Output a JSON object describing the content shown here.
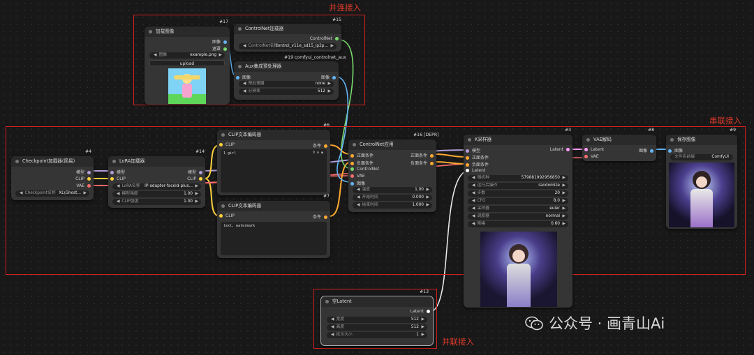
{
  "annotations": {
    "parallel_top": "并连接入",
    "series": "串联接入",
    "parallel_bottom": "并联接入"
  },
  "nodes": {
    "load_image": {
      "id": "#17",
      "title": "加载图像",
      "outputs": [
        "图像",
        "遮罩"
      ],
      "widget_label": "图像",
      "widget_value": "example.png",
      "upload_label": "upload"
    },
    "controlnet_loader": {
      "id": "#15",
      "title": "ControlNet加载器",
      "output": "ControlNet",
      "widget_label": "ControlNet名称",
      "widget_value": "control_v11e_sd15_ip2p..."
    },
    "aux_preprocessor": {
      "id": "#19 comfyui_controlnet_aux",
      "title": "Aux集成预处理器",
      "input": "图像",
      "output": "图像",
      "widgets": [
        {
          "label": "预处理器",
          "value": "none"
        },
        {
          "label": "分辨率",
          "value": "512"
        }
      ]
    },
    "checkpoint_loader": {
      "id": "#4",
      "title": "Checkpoint加载器(简易)",
      "outputs": [
        "模型",
        "CLIP",
        "VAE"
      ],
      "widget_label": "Checkpoint名称",
      "widget_value": "XL\\Ghost..."
    },
    "lora_loader": {
      "id": "#14",
      "title": "LoRA加载器",
      "inputs": [
        "模型",
        "CLIP"
      ],
      "outputs": [
        "模型",
        "CLIP"
      ],
      "widgets": [
        {
          "label": "LoRA名称",
          "value": "IP-adapter-faceid-plus..."
        },
        {
          "label": "模型强度",
          "value": "1.00"
        },
        {
          "label": "CLIP强度",
          "value": "1.00"
        }
      ]
    },
    "clip_text_pos": {
      "id": "#6",
      "title": "CLIP文本编码器",
      "input": "CLIP",
      "output": "条件",
      "text": "1 girl"
    },
    "clip_text_neg": {
      "id": "#7",
      "title": "CLIP文本编码器",
      "input": "CLIP",
      "output": "条件",
      "text": "text, watermark"
    },
    "controlnet_apply": {
      "id": "#16 [DEPR]",
      "title": "ControlNet应用",
      "inputs": [
        "正面条件",
        "负面条件",
        "ControlNet",
        "VAE",
        "图像"
      ],
      "outputs": [
        "正面条件",
        "负面条件"
      ],
      "widgets": [
        {
          "label": "强度",
          "value": "1.00"
        },
        {
          "label": "开始时间",
          "value": "0.000"
        },
        {
          "label": "结束时间",
          "value": "1.000"
        }
      ]
    },
    "ksampler": {
      "id": "#3",
      "title": "K采样器",
      "inputs": [
        "模型",
        "正面条件",
        "负面条件",
        "Latent"
      ],
      "output": "Latent",
      "widgets": [
        {
          "label": "随机种",
          "value": "579881992956850"
        },
        {
          "label": "运行后操作",
          "value": "randomize"
        },
        {
          "label": "步数",
          "value": "20"
        },
        {
          "label": "CFG",
          "value": "8.0"
        },
        {
          "label": "采样器",
          "value": "euler"
        },
        {
          "label": "调度器",
          "value": "normal"
        },
        {
          "label": "降噪",
          "value": "0.60"
        }
      ]
    },
    "vae_decode": {
      "id": "#8",
      "title": "VAE解码",
      "inputs": [
        "Latent",
        "VAE"
      ],
      "output": "图像"
    },
    "save_image": {
      "id": "#9",
      "title": "保存图像",
      "input": "图像",
      "widget_label": "文件名前缀",
      "widget_value": "ComfyUI"
    },
    "empty_latent": {
      "id": "#13",
      "title": "空Latent",
      "output": "Latent",
      "widgets": [
        {
          "label": "宽度",
          "value": "512"
        },
        {
          "label": "高度",
          "value": "512"
        },
        {
          "label": "批次大小",
          "value": "1"
        }
      ]
    }
  },
  "watermark": "公众号 · 画青山Ai",
  "colors": {
    "model": "#b39ddb",
    "clip": "#ffd23c",
    "vae": "#ff6e6e",
    "conditioning": "#ffa931",
    "image": "#64b5f6",
    "latent": "#ff9cf9",
    "controlnet": "#7adb6e",
    "annotation": "#e23b2b"
  }
}
